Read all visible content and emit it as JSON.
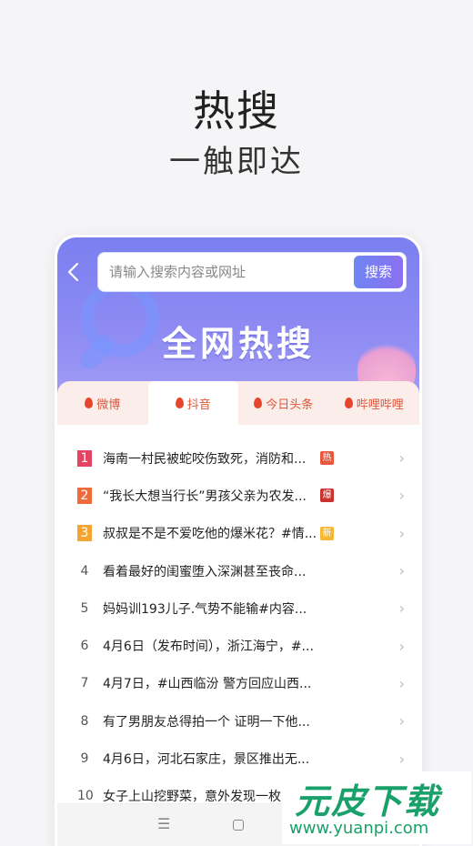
{
  "promo": {
    "headline": "热搜",
    "subline": "一触即达"
  },
  "search": {
    "placeholder": "请输入搜索内容或网址",
    "button_label": "搜索"
  },
  "banner": {
    "title": "全网热搜"
  },
  "tabs": [
    {
      "label": "微博",
      "active": false
    },
    {
      "label": "抖音",
      "active": true
    },
    {
      "label": "今日头条",
      "active": false
    },
    {
      "label": "哔哩哔哩",
      "active": false
    }
  ],
  "list": [
    {
      "rank": "1",
      "text": "海南一村民被蛇咬伤致死，消防和...",
      "badge": "热"
    },
    {
      "rank": "2",
      "text": "“我长大想当行长”男孩父亲为农发...",
      "badge": "爆"
    },
    {
      "rank": "3",
      "text": "叔叔是不是不爱吃他的爆米花？#情...",
      "badge": "新"
    },
    {
      "rank": "4",
      "text": "看着最好的闺蜜堕入深渊甚至丧命...",
      "badge": ""
    },
    {
      "rank": "5",
      "text": "妈妈训193儿子.气势不能输#内容...",
      "badge": ""
    },
    {
      "rank": "6",
      "text": "4月6日（发布时间），浙江海宁，#...",
      "badge": ""
    },
    {
      "rank": "7",
      "text": "4月7日，#山西临汾 警方回应山西...",
      "badge": ""
    },
    {
      "rank": "8",
      "text": "有了男朋友总得拍一个 证明一下他...",
      "badge": ""
    },
    {
      "rank": "9",
      "text": "4月6日，河北石家庄，景区推出无...",
      "badge": ""
    },
    {
      "rank": "10",
      "text": "女子上山挖野菜，意外发现一枚",
      "badge": ""
    }
  ],
  "icons": {
    "back": "chevron-left-icon",
    "chevron": "chevron-right-icon",
    "tab_flame": "flame-icon",
    "nav_menu": "menu-icon",
    "nav_home": "home-icon"
  },
  "colors": {
    "accent": "#e2563c",
    "banner_start": "#7b7ff0",
    "rank1": "#e54361",
    "rank2": "#f06a3a",
    "rank3": "#f4a433"
  },
  "watermark": {
    "title": "元皮下载",
    "url": "www.yuanpi.com"
  }
}
